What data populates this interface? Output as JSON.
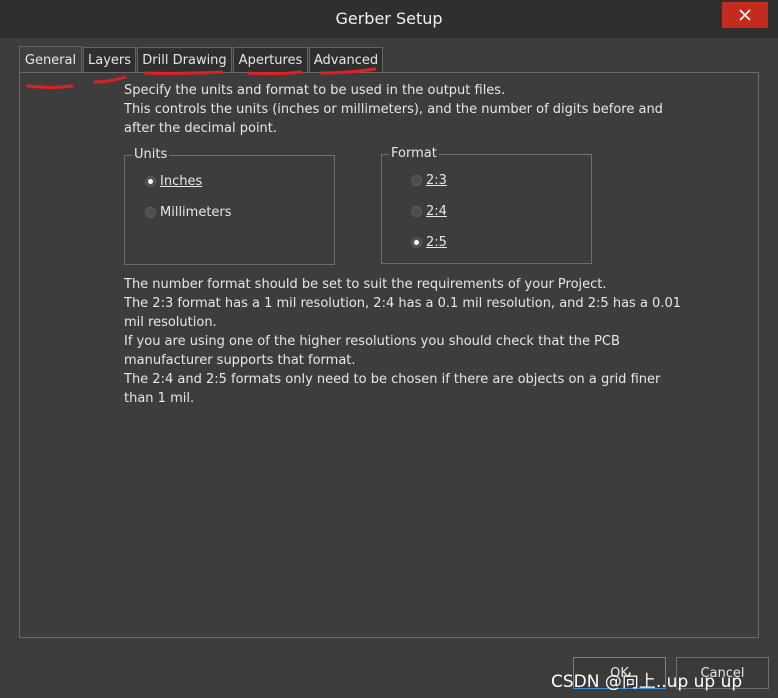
{
  "window": {
    "title": "Gerber Setup",
    "close_icon": "close-icon"
  },
  "tabs": [
    {
      "label": "General",
      "active": true
    },
    {
      "label": "Layers",
      "active": false
    },
    {
      "label": "Drill Drawing",
      "active": false
    },
    {
      "label": "Apertures",
      "active": false
    },
    {
      "label": "Advanced",
      "active": false
    }
  ],
  "general": {
    "intro": [
      "Specify the units and format to be used in the output files.",
      "This controls the units (inches or millimeters), and the number of digits before and",
      "after the decimal point."
    ],
    "units": {
      "label": "Units",
      "options": [
        {
          "label": "Inches",
          "checked": true
        },
        {
          "label": "Millimeters",
          "checked": false
        }
      ]
    },
    "format": {
      "label": "Format",
      "options": [
        {
          "label": "2:3",
          "checked": false
        },
        {
          "label": "2:4",
          "checked": false
        },
        {
          "label": "2:5",
          "checked": true
        }
      ]
    },
    "notes": [
      "The number format should be set to suit the requirements of your Project.",
      "The 2:3 format has a 1 mil resolution, 2:4 has a 0.1 mil resolution, and 2:5 has a 0.01",
      "mil resolution.",
      "If you are using one of the higher resolutions you should check that the PCB",
      "manufacturer supports that format.",
      "The 2:4 and 2:5 formats only need to be chosen if there are objects on a grid finer",
      "than 1 mil."
    ]
  },
  "buttons": {
    "ok": "OK",
    "cancel": "Cancel"
  },
  "watermark": "CSDN @向上..up up up",
  "colors": {
    "annotation": "#e02020",
    "close": "#c42b1c",
    "focus": "#3d8fd6"
  }
}
